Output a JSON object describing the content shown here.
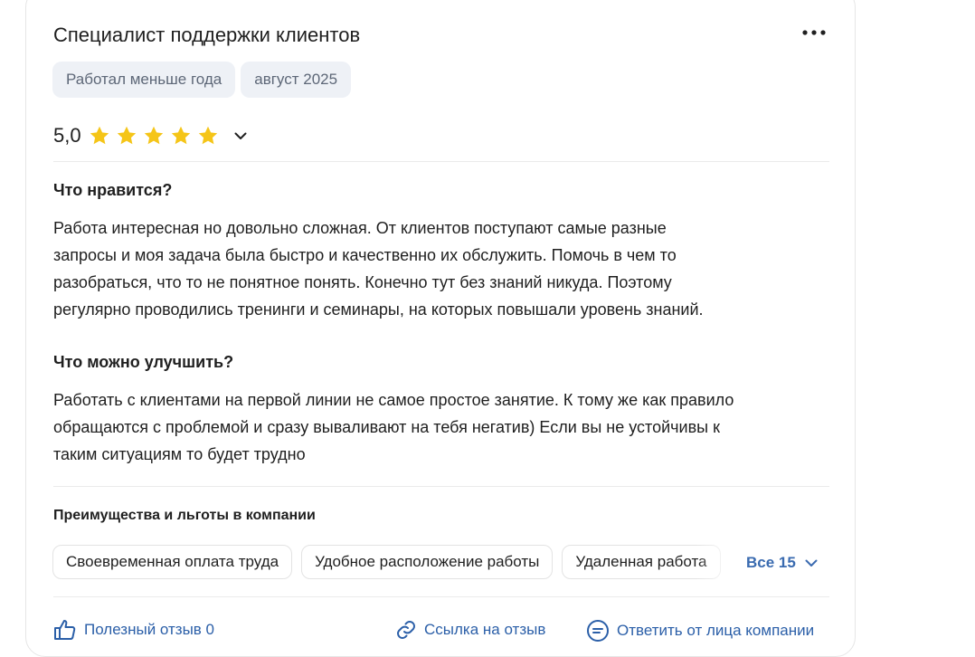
{
  "review": {
    "title": "Специалист поддержки клиентов",
    "tags": [
      "Работал меньше года",
      "август 2025"
    ],
    "rating": {
      "value": "5,0",
      "stars": 5,
      "max": 5
    },
    "pros": {
      "heading": "Что нравится?",
      "lines": [
        "Работа интересная но довольно сложная. От клиентов поступают самые разные",
        "запросы и моя задача была быстро и качественно их обслужить. Помочь в чем то",
        "разобраться, что то не понятное понять. Конечно тут без знаний никуда. Поэтому",
        "регулярно проводились тренинги и семинары, на которых повышали уровень знаний."
      ]
    },
    "cons": {
      "heading": "Что можно улучшить?",
      "lines": [
        "Работать с клиентами на первой линии не самое простое занятие. К тому же как правило",
        "обращаются с проблемой и сразу вываливают на тебя негатив) Если вы не устойчивы к",
        "таким ситуациям то будет трудно"
      ]
    },
    "benefits": {
      "heading": "Преимущества и льготы в компании",
      "chips": [
        "Своевременная оплата труда",
        "Удобное расположение работы",
        "Удаленная работа"
      ],
      "all_label": "Все 15"
    },
    "actions": {
      "helpful": "Полезный отзыв 0",
      "link": "Ссылка на отзыв",
      "reply": "Ответить от лица компании"
    }
  },
  "colors": {
    "star": "#f5c518",
    "link": "#2b5fa8",
    "tag_bg": "#eef1f6",
    "tag_text": "#5d6777"
  },
  "icons": {
    "more": "more-dots-icon",
    "rating_expand": "chevron-down-icon",
    "all_expand": "chevron-down-icon",
    "helpful": "thumbs-up-icon",
    "link": "link-icon",
    "reply": "comment-icon"
  }
}
